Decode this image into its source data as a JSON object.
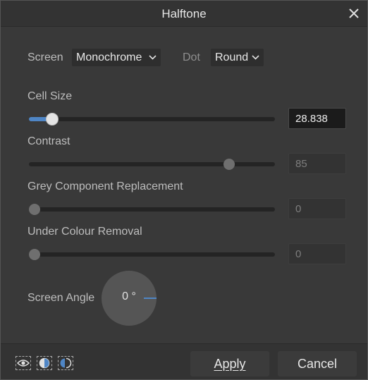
{
  "dialog": {
    "title": "Halftone"
  },
  "options": {
    "screen_label": "Screen",
    "screen_value": "Monochrome",
    "dot_label": "Dot",
    "dot_value": "Round"
  },
  "sliders": [
    {
      "label": "Cell Size",
      "value": "28.838",
      "fraction": 0.076,
      "active": true
    },
    {
      "label": "Contrast",
      "value": "85",
      "fraction": 0.83,
      "active": false
    },
    {
      "label": "Grey Component Replacement",
      "value": "0",
      "fraction": 0.0,
      "active": false
    },
    {
      "label": "Under Colour Removal",
      "value": "0",
      "fraction": 0.0,
      "active": false
    }
  ],
  "screen_angle": {
    "label": "Screen Angle",
    "value": "0 °"
  },
  "footer": {
    "apply_label": "Apply",
    "cancel_label": "Cancel"
  },
  "icons": {
    "close": "close-icon",
    "preview": "eye-icon",
    "split": "split-view-icon",
    "mirror": "mirror-view-icon"
  },
  "colors": {
    "accent": "#4f86c6"
  }
}
